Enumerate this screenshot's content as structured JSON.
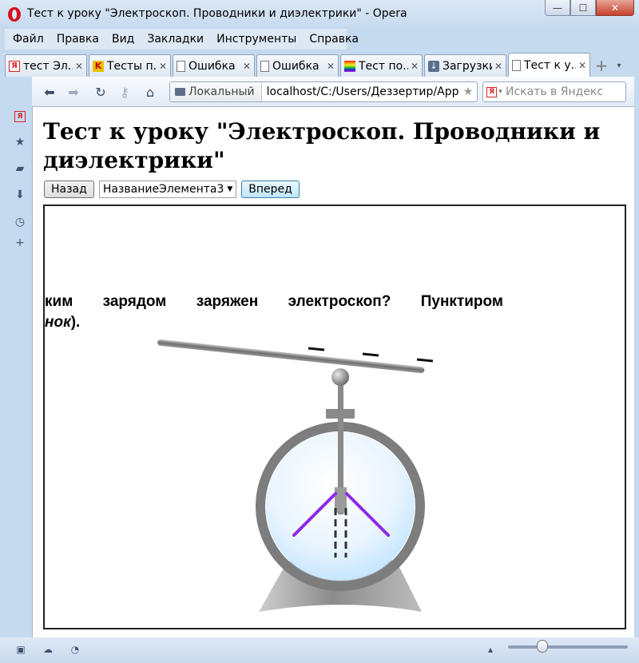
{
  "window": {
    "title": "Тест к уроку \"Электроскоп. Проводники и диэлектрики\" - Opera",
    "minimize_glyph": "—",
    "maximize_glyph": "☐",
    "close_glyph": "✕"
  },
  "menu": [
    "Файл",
    "Правка",
    "Вид",
    "Закладки",
    "Инструменты",
    "Справка"
  ],
  "tabs": [
    {
      "icon": "yandex-icon",
      "label": "тест Эл..."
    },
    {
      "icon": "k-icon",
      "label": "Тесты п..."
    },
    {
      "icon": "document-icon",
      "label": "Ошибка"
    },
    {
      "icon": "document-icon",
      "label": "Ошибка"
    },
    {
      "icon": "rainbow-icon",
      "label": "Тест по..."
    },
    {
      "icon": "download-icon",
      "label": "Загрузки"
    },
    {
      "icon": "document-icon",
      "label": "Тест к у..."
    }
  ],
  "tab_close_glyph": "✕",
  "address_bar": {
    "badge": "Локальный",
    "url": "localhost/C:/Users/Деззертир/AppD"
  },
  "search": {
    "placeholder": "Искать в Яндекс",
    "engine_letter": "Я"
  },
  "page": {
    "title": "Тест к уроку \"Электроскоп. Проводники и диэлектрики\"",
    "back_label": "Назад",
    "select_value": "НазваниеЭлемента3",
    "forward_label": "Вперед"
  },
  "question": {
    "line1_words": [
      "ким",
      "зарядом",
      "заряжен",
      "электроскоп?",
      "Пунктиром"
    ],
    "line2_italic": "нок",
    "line2_tail": ")."
  },
  "colors": {
    "accent": "#8f2be2",
    "frame_border": "#222222",
    "metal": "#8a8a8a"
  }
}
